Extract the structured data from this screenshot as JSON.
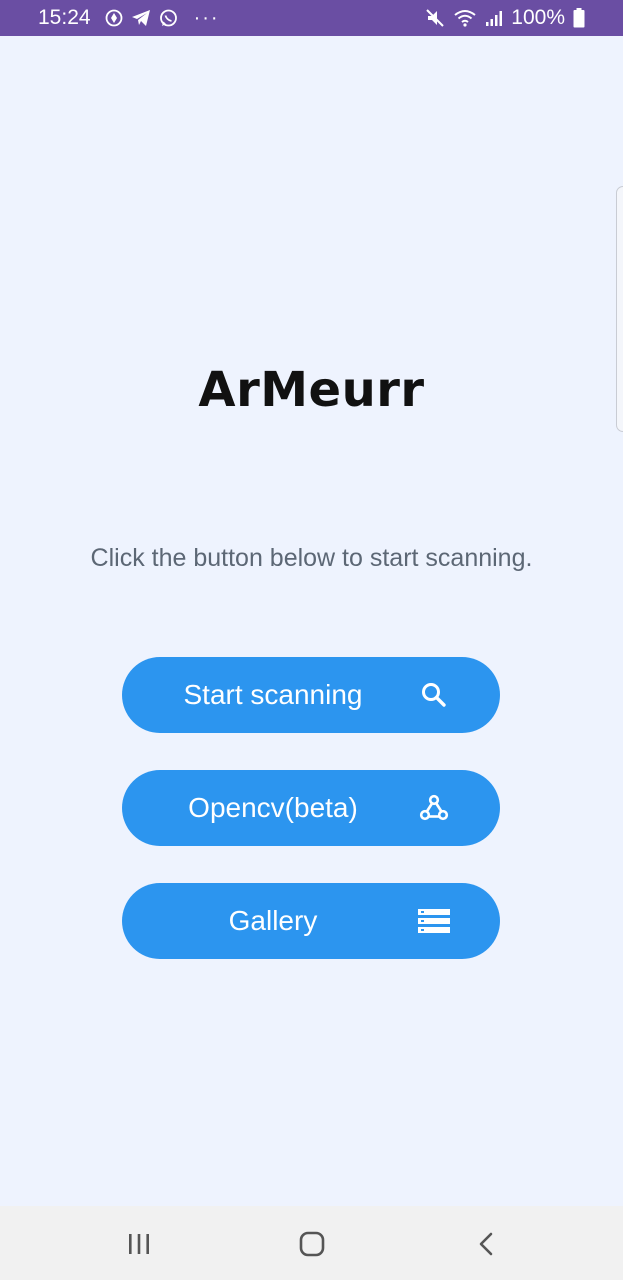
{
  "status_bar": {
    "time": "15:24",
    "overflow": "···",
    "battery_text": "100%",
    "left_icons": [
      "maps-pin-icon",
      "telegram-icon",
      "whatsapp-icon"
    ],
    "right_icons": [
      "mute-icon",
      "wifi-icon",
      "signal-icon",
      "battery-icon"
    ]
  },
  "app": {
    "logo_text": "ArMeurr",
    "instruction": "Click the button below to start scanning."
  },
  "buttons": {
    "start": {
      "label": "Start scanning",
      "icon": "search-icon"
    },
    "opencv": {
      "label": "Opencv(beta)",
      "icon": "webhook-icon"
    },
    "gallery": {
      "label": "Gallery",
      "icon": "list-icon"
    }
  },
  "nav": {
    "icons": [
      "recents-icon",
      "home-icon",
      "back-icon"
    ]
  },
  "colors": {
    "status_bar": "#6a4ea3",
    "background": "#eef3fe",
    "button": "#2c95ef",
    "nav_bar": "#f1f1f1"
  }
}
